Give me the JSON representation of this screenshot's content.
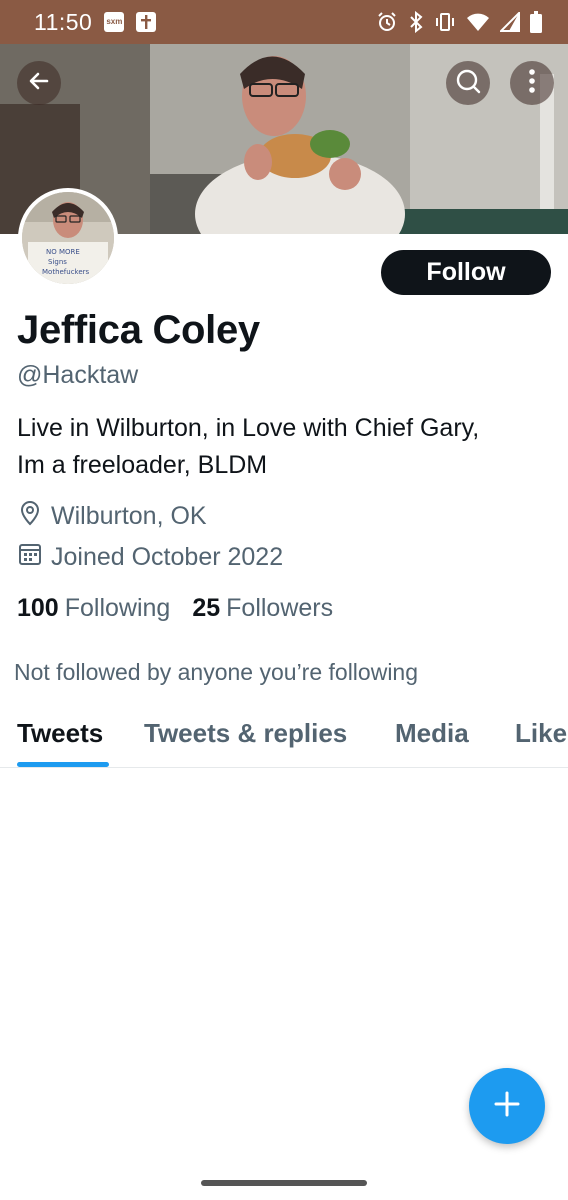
{
  "status_bar": {
    "time": "11:50",
    "notifications": [
      "sxm",
      "bible"
    ],
    "icons": [
      "alarm-icon",
      "bluetooth-icon",
      "vibrate-icon",
      "wifi-icon",
      "signal-icon",
      "battery-icon"
    ]
  },
  "header": {
    "back_icon": "arrow-left-icon",
    "search_icon": "search-icon",
    "more_icon": "more-vertical-icon"
  },
  "profile": {
    "follow_label": "Follow",
    "name": "Jeffica Coley",
    "handle": "@Hacktaw",
    "bio_line1": "Live in Wilburton, in Love with Chief Gary,",
    "bio_line2": "Im a freeloader, BLDM",
    "location": "Wilburton, OK",
    "joined": "Joined October 2022",
    "following_count": "100",
    "following_label": "Following",
    "followers_count": "25",
    "followers_label": "Followers",
    "not_followed_text": "Not followed by anyone you’re following",
    "avatar_sign_text": "NO MORE Signs Motherfuckers"
  },
  "tabs": [
    {
      "label": "Tweets",
      "active": true
    },
    {
      "label": "Tweets & replies",
      "active": false
    },
    {
      "label": "Media",
      "active": false
    },
    {
      "label": "Likes",
      "active": false
    }
  ],
  "fab": {
    "icon": "plus-icon"
  },
  "colors": {
    "status_bar": "#8a5a44",
    "accent": "#1d9bf0",
    "text_primary": "#0f1419",
    "text_secondary": "#536471"
  }
}
